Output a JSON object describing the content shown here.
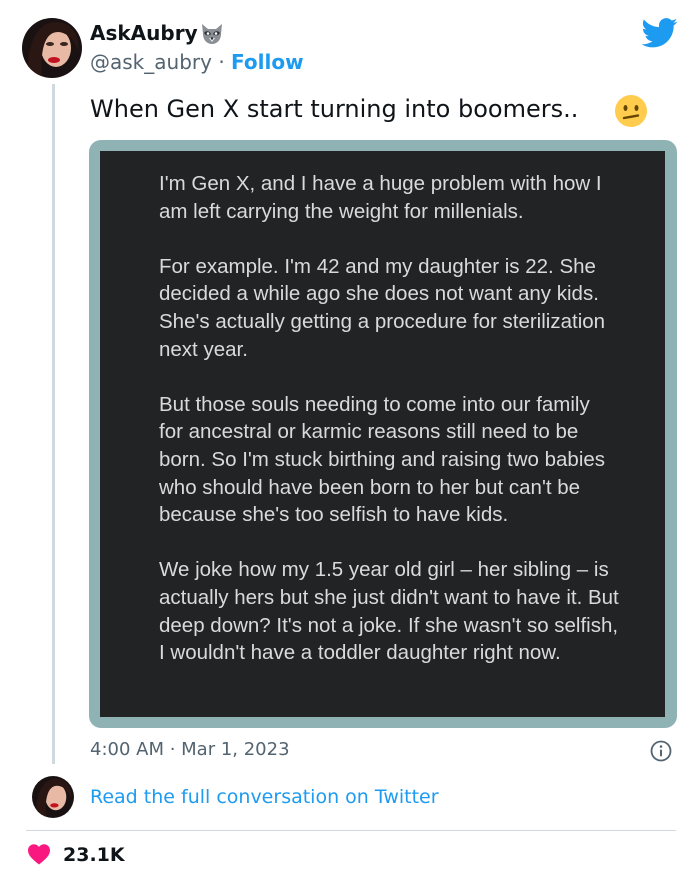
{
  "tweet": {
    "author_name": "AskAubry",
    "author_handle": "@ask_aubry",
    "separator": "·",
    "follow_label": "Follow",
    "text": "When Gen X start turning into boomers..",
    "emoji_icon": "confused-face-icon",
    "timestamp": "4:00 AM · Mar 1, 2023",
    "read_more_label": "Read the full conversation on Twitter",
    "like_count": "23.1K",
    "brand_color": "#1d9bf0",
    "heart_color": "#f91880"
  },
  "embedded_post": {
    "paragraphs": [
      "I'm Gen X, and I have a huge problem with how I am left carrying the weight for millenials.",
      "For example. I'm 42 and my daughter is 22. She decided a while ago she does not want any kids. She's actually getting a procedure for sterilization next year.",
      "But those souls needing to come into our family for ancestral or karmic reasons still need to be born. So I'm stuck birthing and raising two babies who should have been born to her but can't be because she's too selfish to have kids.",
      "We joke how my 1.5 year old girl – her sibling – is actually hers but she just didn't want to have it. But deep down? It's not a joke. If she wasn't so selfish, I wouldn't have a toddler daughter right now."
    ]
  }
}
